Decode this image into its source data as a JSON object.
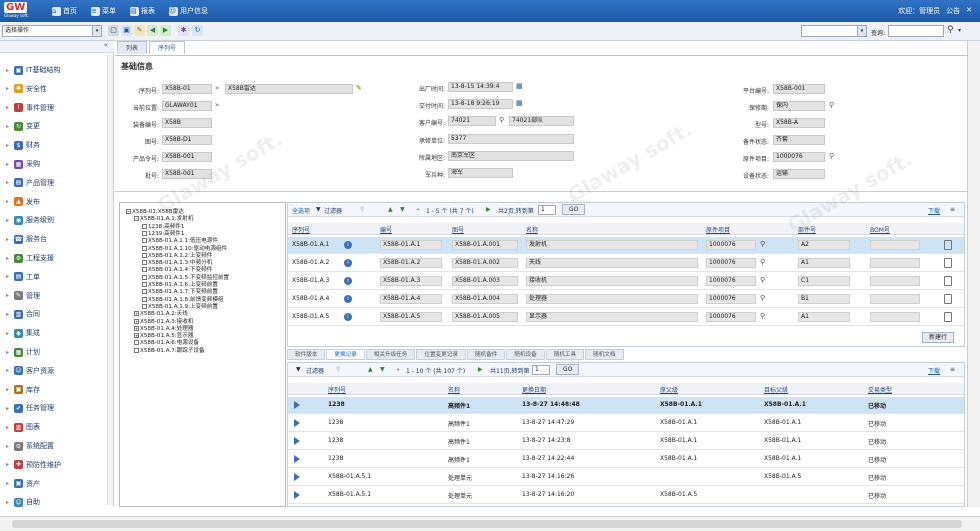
{
  "logo": {
    "mark": "GW",
    "sub": "Glaway soft."
  },
  "topnav": [
    {
      "icon": "home-icon",
      "glyph": "⌂",
      "label": "首页"
    },
    {
      "icon": "menu-icon",
      "glyph": "≡",
      "label": "菜单"
    },
    {
      "icon": "report-icon",
      "glyph": "▤",
      "label": "报表"
    },
    {
      "icon": "user-info-icon",
      "glyph": "☺",
      "label": "用户信息"
    }
  ],
  "topright": {
    "welcome": "欢迎：管理员",
    "company": "公告",
    "close": "✕"
  },
  "toolbar": {
    "operation_select": "选择操作",
    "search_label": "查询:",
    "search_value": ""
  },
  "sidebar": {
    "collapse": "«",
    "items": [
      {
        "label": "IT基础结构",
        "color": "#3a6fb8",
        "glyph": "▣"
      },
      {
        "label": "安全性",
        "color": "#e0a020",
        "glyph": "✱"
      },
      {
        "label": "事件管理",
        "color": "#c04040",
        "glyph": "!"
      },
      {
        "label": "变更",
        "color": "#4a8a3a",
        "glyph": "↻"
      },
      {
        "label": "财务",
        "color": "#3a6fb8",
        "glyph": "$"
      },
      {
        "label": "采购",
        "color": "#7a4ab0",
        "glyph": "▦"
      },
      {
        "label": "产品管理",
        "color": "#3a6fb8",
        "glyph": "▤"
      },
      {
        "label": "发布",
        "color": "#e07020",
        "glyph": "▲"
      },
      {
        "label": "服务级别",
        "color": "#3a8ab0",
        "glyph": "◉"
      },
      {
        "label": "服务台",
        "color": "#3a6fb8",
        "glyph": "☎"
      },
      {
        "label": "工程支援",
        "color": "#4a8a3a",
        "glyph": "⚙"
      },
      {
        "label": "工单",
        "color": "#3a6fb8",
        "glyph": "▤"
      },
      {
        "label": "管理",
        "color": "#7a7a7a",
        "glyph": "✎"
      },
      {
        "label": "合同",
        "color": "#3a6fb8",
        "glyph": "▥"
      },
      {
        "label": "集成",
        "color": "#3a8ab0",
        "glyph": "◆"
      },
      {
        "label": "计划",
        "color": "#4a8a3a",
        "glyph": "▦"
      },
      {
        "label": "客户资源",
        "color": "#3a6fb8",
        "glyph": "☺"
      },
      {
        "label": "库存",
        "color": "#b07020",
        "glyph": "▣"
      },
      {
        "label": "任务管理",
        "color": "#3a6fb8",
        "glyph": "✔"
      },
      {
        "label": "图表",
        "color": "#c04040",
        "glyph": "▥"
      },
      {
        "label": "系统配置",
        "color": "#7a7a7a",
        "glyph": "⚙"
      },
      {
        "label": "预防性维护",
        "color": "#c04040",
        "glyph": "✚"
      },
      {
        "label": "资产",
        "color": "#3a6fb8",
        "glyph": "▣"
      },
      {
        "label": "自助",
        "color": "#3a8ab0",
        "glyph": "☺"
      }
    ]
  },
  "tabs": [
    "列表",
    "序列号"
  ],
  "section_title": "基础信息",
  "form": {
    "serial_label": "序列号:",
    "serial_value": "X58B-01",
    "serial_desc": "X58B雷达",
    "location_label": "当前位置:",
    "location_value": "GLAWAY01",
    "device_label": "装备编号:",
    "device_value": "X58B",
    "drawing_label": "图号:",
    "drawing_value": "X58B-D1",
    "product_label": "产品令号:",
    "product_value": "X58B-001",
    "batch_label": "批号:",
    "batch_value": "X58B-001",
    "out_time_label": "出厂时间:",
    "out_time_value": "13-8-15 14:39:4",
    "deliver_time_label": "交付时间:",
    "deliver_time_value": "13-8-18 9:26:19",
    "customer_label": "客户编号:",
    "customer_value": "74021",
    "customer_name": "74021部队",
    "repair_unit_label": "承修单位:",
    "repair_unit_value": "5377",
    "area_label": "所属地区:",
    "area_value": "南京军区",
    "branch_label": "军兵种:",
    "branch_value": "海军",
    "platform_label": "平台编号:",
    "platform_value": "X58B-001",
    "warranty_label": "保修期:",
    "warranty_value": "保内",
    "model_label": "型号:",
    "model_value": "X58B-A",
    "spare_label": "备件状态:",
    "spare_value": "齐套",
    "outsrc_label": "原件项目:",
    "outsrc_value": "1000076",
    "status_label": "设备状态:",
    "status_value": "运输"
  },
  "tree": [
    {
      "text": "X58B-01:X58B雷达",
      "lvl": 0,
      "box": "−"
    },
    {
      "text": "X58B-01.A.1:发射机",
      "lvl": 1,
      "box": "−"
    },
    {
      "text": "1238:高频件1",
      "lvl": 2,
      "box": ""
    },
    {
      "text": "1239:高频件1",
      "lvl": 2,
      "box": ""
    },
    {
      "text": "X58B-01.A.1.1:低压电源件",
      "lvl": 2,
      "box": ""
    },
    {
      "text": "X58B-01.A.1.10:驱动电源组件",
      "lvl": 2,
      "box": ""
    },
    {
      "text": "X58B-01.A.1.2:上变频件",
      "lvl": 2,
      "box": ""
    },
    {
      "text": "X58B-01.A.1.3:中频分机",
      "lvl": 2,
      "box": ""
    },
    {
      "text": "X58B-01.A.1.4:下变频件",
      "lvl": 2,
      "box": ""
    },
    {
      "text": "X58B-01.A.1.5:下变频监控前置",
      "lvl": 2,
      "box": ""
    },
    {
      "text": "X58B-01.A.1.6:上变频前置",
      "lvl": 2,
      "box": ""
    },
    {
      "text": "X58B-01.A.1.7:下变频前置",
      "lvl": 2,
      "box": ""
    },
    {
      "text": "X58B-01.A.1.8:前馈变频模组",
      "lvl": 2,
      "box": ""
    },
    {
      "text": "X58B-01.A.1.9:上变频前置",
      "lvl": 2,
      "box": ""
    },
    {
      "text": "X58B-01.A.2:天线",
      "lvl": 1,
      "box": "+"
    },
    {
      "text": "X58B-01.A.3:接收机",
      "lvl": 1,
      "box": "+"
    },
    {
      "text": "X58B-01.A.4:处理器",
      "lvl": 1,
      "box": "+"
    },
    {
      "text": "X58B-01.A.5:显示器",
      "lvl": 1,
      "box": "+"
    },
    {
      "text": "X58B-01.A.6:电源设备",
      "lvl": 1,
      "box": ""
    },
    {
      "text": "X58B-01.A.7:跟踪子设备",
      "lvl": 1,
      "box": ""
    }
  ],
  "grid1": {
    "tools": {
      "filter_label": "过滤器",
      "view_label": "查找",
      "page_info": "1 - 5 个 (共 7 个)",
      "jump_label": "共2页,转到第",
      "page_value": "1",
      "go": "GO",
      "download": "下载"
    },
    "headers": [
      "序列号",
      "编号",
      "图号",
      "名称",
      "原件项目",
      "部件号",
      "BOM号"
    ],
    "rows": [
      {
        "c0": "X58B-01.A.1",
        "c1": "X58B-01.A.1",
        "c2": "X58B-01.A.001",
        "c3": "发射机",
        "c4": "1000076",
        "c5": "A2",
        "c6": ""
      },
      {
        "c0": "X58B-01.A.2",
        "c1": "X58B-01.A.2",
        "c2": "X58B-01.A.002",
        "c3": "天线",
        "c4": "1000076",
        "c5": "A1",
        "c6": ""
      },
      {
        "c0": "X58B-01.A.3",
        "c1": "X58B-01.A.3",
        "c2": "X58B-01.A.003",
        "c3": "接收机",
        "c4": "1000076",
        "c5": "C1",
        "c6": ""
      },
      {
        "c0": "X58B-01.A.4",
        "c1": "X58B-01.A.4",
        "c2": "X58B-01.A.004",
        "c3": "处理器",
        "c4": "1000076",
        "c5": "B1",
        "c6": ""
      },
      {
        "c0": "X58B-01.A.5",
        "c1": "X58B-01.A.5",
        "c2": "X58B-01.A.005",
        "c3": "显示器",
        "c4": "1000076",
        "c5": "A1",
        "c6": ""
      }
    ],
    "new_row": "新建行"
  },
  "subtabs": [
    "软件版本",
    "更换记录",
    "相关升级任务",
    "位置变更记录",
    "随机备件",
    "随机设备",
    "随机工具",
    "随机文档"
  ],
  "grid2": {
    "tools": {
      "filter_label": "过滤器",
      "page_info": "1 - 10 个 (共 107 个)",
      "jump_label": "共11页,转到第",
      "page_value": "1",
      "go": "GO",
      "download": "下载"
    },
    "headers": [
      "序列号",
      "名称",
      "更换日期",
      "原父级",
      "目标父级",
      "交易类型"
    ],
    "rows": [
      {
        "c0": "1238",
        "c1": "高频件1",
        "c2": "13-8-27 14:48:48",
        "c3": "X58B-01.A.1",
        "c4": "X58B-01.A.1",
        "c5": "已移动"
      },
      {
        "c0": "1238",
        "c1": "高频件1",
        "c2": "13-8-27 14:47:29",
        "c3": "X58B-01.A.1",
        "c4": "X58B-01.A.1",
        "c5": "已移动"
      },
      {
        "c0": "1238",
        "c1": "高频件1",
        "c2": "13-8-27 14:23:8",
        "c3": "X58B-01.A.1",
        "c4": "X58B-01.A.1",
        "c5": "已移动"
      },
      {
        "c0": "1238",
        "c1": "高频件1",
        "c2": "13-8-27 14:22:44",
        "c3": "X58B-01.A.1",
        "c4": "X58B-01.A.1",
        "c5": "已移动"
      },
      {
        "c0": "X58B-01.A.5.1",
        "c1": "处理单元",
        "c2": "13-8-27 14:16:26",
        "c3": "",
        "c4": "X58B-01.A.5",
        "c5": "已移动"
      },
      {
        "c0": "X58B-01.A.5.1",
        "c1": "处理单元",
        "c2": "13-8-27 14:16:20",
        "c3": "X58B-01.A.5",
        "c4": "",
        "c5": "已移动"
      }
    ]
  },
  "watermark": "Glaway soft."
}
